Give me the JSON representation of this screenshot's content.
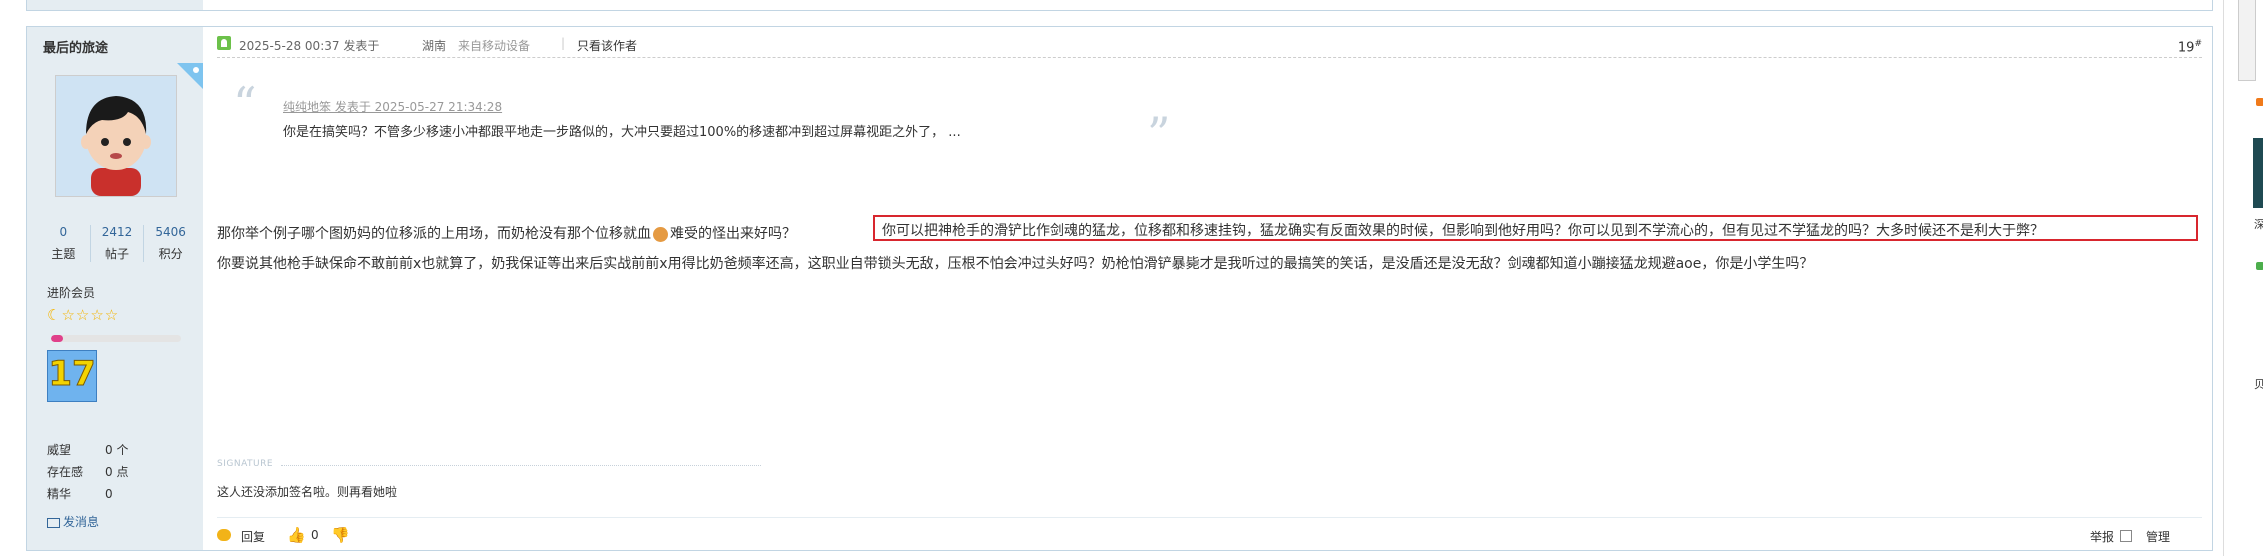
{
  "post": {
    "author": "最后的旅途",
    "stats": [
      {
        "value": "0",
        "label": "主题"
      },
      {
        "value": "2412",
        "label": "帖子"
      },
      {
        "value": "5406",
        "label": "积分"
      }
    ],
    "rank": "进阶会员",
    "stars": "☾☆☆☆☆",
    "level_progress": 0.09,
    "medal_number": "17",
    "attributes": [
      {
        "key": "威望",
        "value": "0 个"
      },
      {
        "key": "存在感",
        "value": "0 点"
      },
      {
        "key": "精华",
        "value": "0"
      }
    ],
    "pm_label": "发消息",
    "header": {
      "datetime": "2025-5-28 00:37 发表于",
      "location": "湖南",
      "device": "来自移动设备",
      "separator": "|",
      "only_author": "只看该作者",
      "floor": "19",
      "floor_mark": "#"
    },
    "quote": {
      "author_line": "纯纯地笨 发表于 2025-05-27 21:34:28",
      "text": "你是在搞笑吗？不管多少移速小冲都跟平地走一步路似的，大冲只要超过100%的移速都冲到超过屏幕视距之外了， ..."
    },
    "body": {
      "line1_a": "那你举个例子哪个图奶妈的位移派的上用场，而奶枪没有那个位移就血",
      "line1_b": "难受的怪出来好吗？",
      "highlight": "你可以把神枪手的滑铲比作剑魂的猛龙，位移都和移速挂钩，猛龙确实有反面效果的时候，但影响到他好用吗？你可以见到不学流心的，但有见过不学猛龙的吗？大多时候还不是利大于弊？",
      "line2": "你要说其他枪手缺保命不敢前前x也就算了，奶我保证等出来后实战前前x用得比奶爸频率还高，这职业自带锁头无敌，压根不怕会冲过头好吗？奶枪怕滑铲暴毙才是我听过的最搞笑的笑话，是没盾还是没无敌？剑魂都知道小蹦接猛龙规避aoe，你是小学生吗？"
    },
    "signature_label": "SIGNATURE",
    "signature": "这人还没添加签名啦。则再看她啦",
    "actions": {
      "reply": "回复",
      "likes": "0",
      "report": "举报",
      "manage": "管理"
    }
  },
  "right_rail": {
    "text1": "深",
    "text2": "贝"
  }
}
